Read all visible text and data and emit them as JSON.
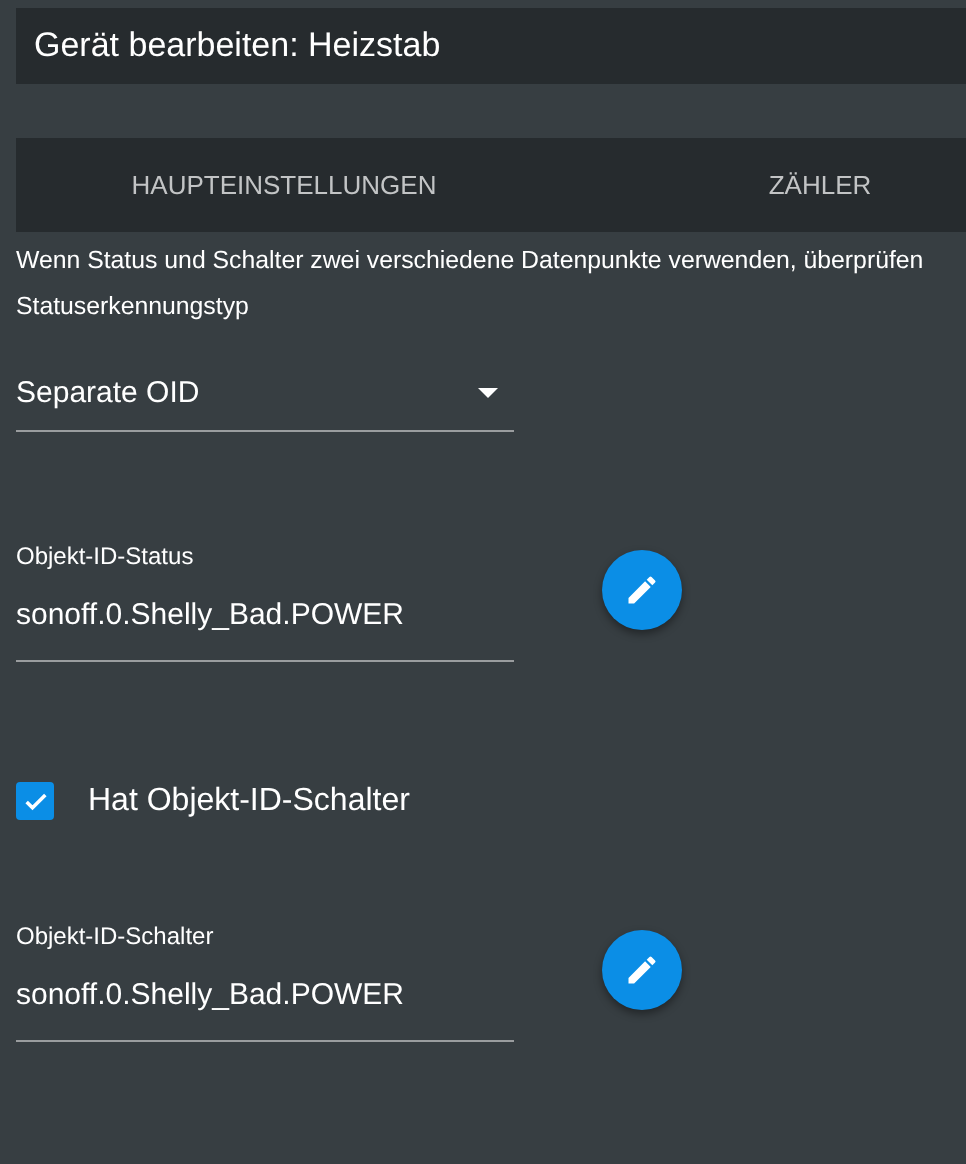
{
  "window": {
    "title": "Gerät bearbeiten: Heizstab"
  },
  "tabs": [
    {
      "label": "HAUPTEINSTELLUNGEN"
    },
    {
      "label": "ZÄHLER"
    }
  ],
  "description": "Wenn Status und Schalter zwei verschiedene Datenpunkte verwenden, überprüfen",
  "status_type": {
    "label": "Statuserkennungstyp",
    "value": "Separate OID"
  },
  "fields": [
    {
      "kind": "oid",
      "label": "Objekt-ID-Status",
      "value": "sonoff.0.Shelly_Bad.POWER"
    },
    {
      "kind": "checkbox",
      "label": "Hat Objekt-ID-Schalter",
      "checked": true
    },
    {
      "kind": "oid",
      "label": "Objekt-ID-Schalter",
      "value": "sonoff.0.Shelly_Bad.POWER"
    }
  ]
}
